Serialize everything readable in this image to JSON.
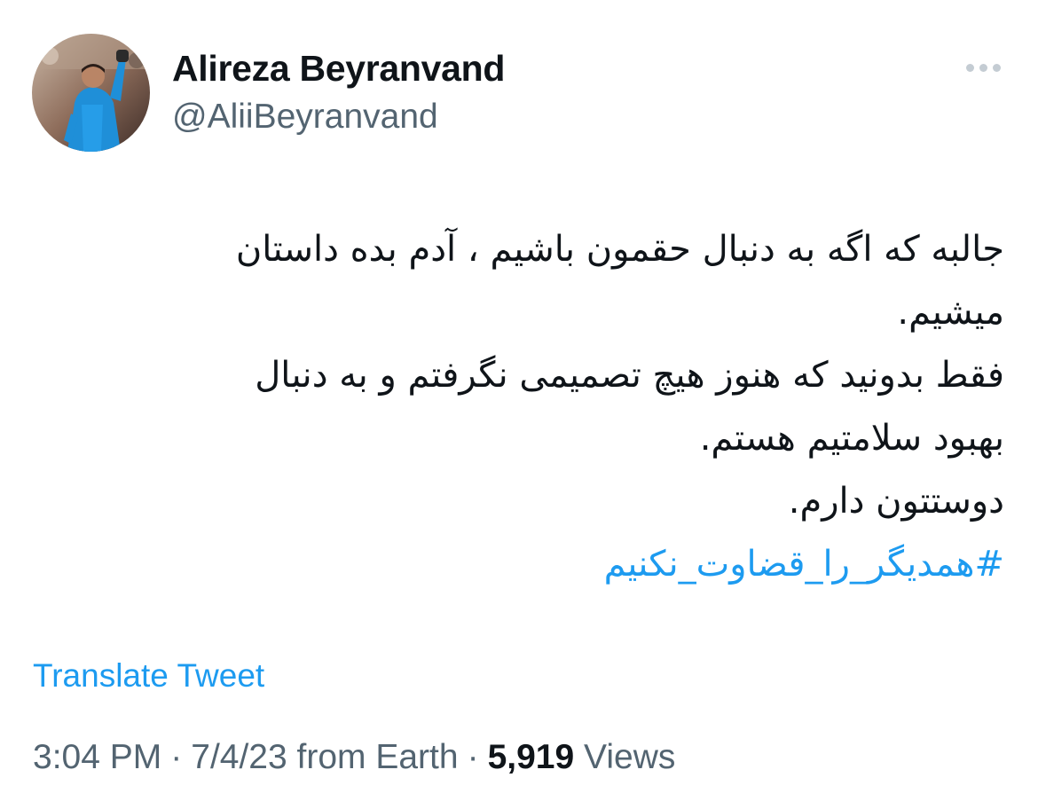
{
  "author": {
    "display_name": "Alireza Beyranvand",
    "handle": "@AliiBeyranvand"
  },
  "tweet": {
    "lines": [
      "جالبه که اگه به دنبال حقمون باشیم ، آدم بده داستان",
      "میشیم.",
      "فقط بدونید که هنوز هیچ تصمیمی نگرفتم و به دنبال",
      "بهبود سلامتیم هستم.",
      "دوستتون دارم."
    ],
    "hashtag": "#همدیگر_را_قضاوت_نکنیم"
  },
  "translate_label": "Translate Tweet",
  "meta": {
    "time": "3:04 PM",
    "separator": "·",
    "date": "7/4/23 from Earth",
    "views_count": "5,919",
    "views_label": "Views"
  },
  "icons": {
    "more": "more-horizontal-icon"
  },
  "colors": {
    "link": "#1d9bf0",
    "secondary_text": "#536471",
    "primary_text": "#0f1419"
  }
}
